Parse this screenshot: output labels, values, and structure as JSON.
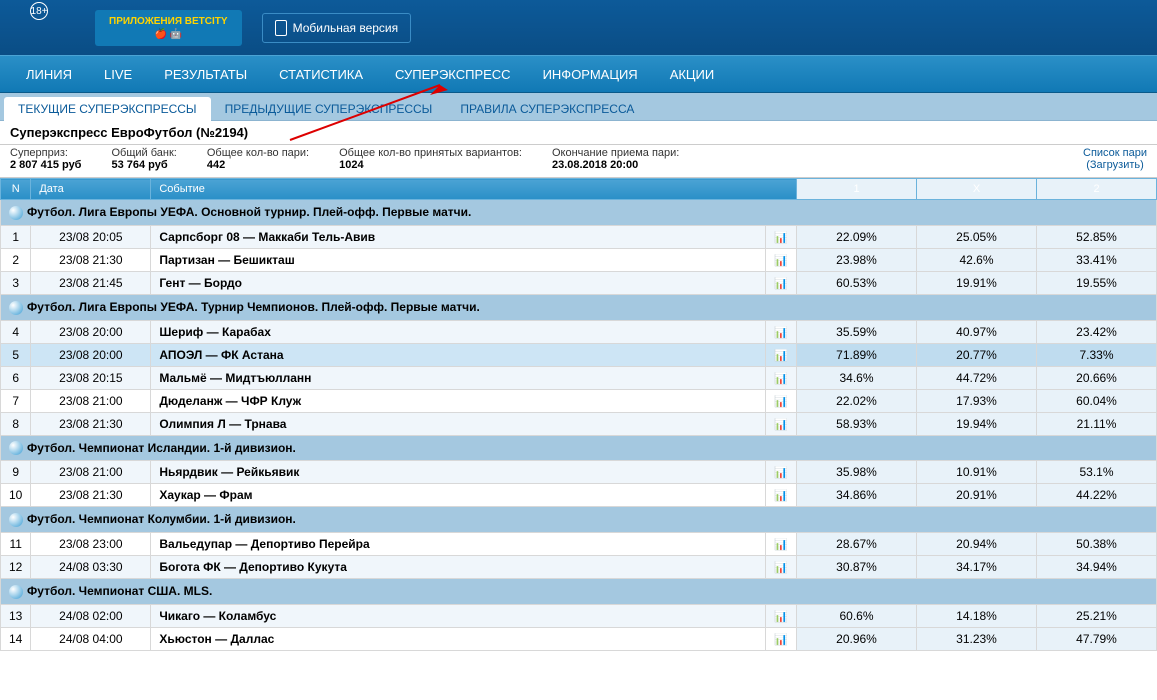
{
  "header": {
    "age": "18+",
    "app_btn": "ПРИЛОЖЕНИЯ BETCITY",
    "mobile_btn": "Мобильная версия"
  },
  "nav": [
    "ЛИНИЯ",
    "LIVE",
    "РЕЗУЛЬТАТЫ",
    "СТАТИСТИКА",
    "СУПЕРЭКСПРЕСС",
    "ИНФОРМАЦИЯ",
    "АКЦИИ"
  ],
  "subnav": [
    "ТЕКУЩИЕ СУПЕРЭКСПРЕССЫ",
    "ПРЕДЫДУЩИЕ СУПЕРЭКСПРЕССЫ",
    "ПРАВИЛА СУПЕРЭКСПРЕССА"
  ],
  "title": "Суперэкспресс ЕвроФутбол (№2194)",
  "info": {
    "superprize_label": "Суперприз:",
    "superprize_value": "2 807 415 руб",
    "bank_label": "Общий банк:",
    "bank_value": "53 764 руб",
    "pari_label": "Общее кол-во пари:",
    "pari_value": "442",
    "variants_label": "Общее кол-во принятых вариантов:",
    "variants_value": "1024",
    "deadline_label": "Окончание приема пари:",
    "deadline_value": "23.08.2018 20:00",
    "link1": "Список пари",
    "link2": "(Загрузить)"
  },
  "th": {
    "n": "N",
    "date": "Дата",
    "event": "Событие",
    "c1": "1",
    "cx": "X",
    "c2": "2"
  },
  "groups": [
    {
      "title": "Футбол. Лига Европы УЕФА. Основной турнир. Плей-офф. Первые матчи.",
      "rows": [
        {
          "n": "1",
          "date": "23/08 20:05",
          "event": "Сарпсборг 08 — Маккаби Тель-Авив",
          "o1": "22.09%",
          "ox": "25.05%",
          "o2": "52.85%"
        },
        {
          "n": "2",
          "date": "23/08 21:30",
          "event": "Партизан — Бешикташ",
          "o1": "23.98%",
          "ox": "42.6%",
          "o2": "33.41%"
        },
        {
          "n": "3",
          "date": "23/08 21:45",
          "event": "Гент — Бордо",
          "o1": "60.53%",
          "ox": "19.91%",
          "o2": "19.55%"
        }
      ]
    },
    {
      "title": "Футбол. Лига Европы УЕФА. Турнир Чемпионов. Плей-офф. Первые матчи.",
      "rows": [
        {
          "n": "4",
          "date": "23/08 20:00",
          "event": "Шериф — Карабах",
          "o1": "35.59%",
          "ox": "40.97%",
          "o2": "23.42%"
        },
        {
          "n": "5",
          "date": "23/08 20:00",
          "event": "АПОЭЛ — ФК Астана",
          "o1": "71.89%",
          "ox": "20.77%",
          "o2": "7.33%",
          "selected": true
        },
        {
          "n": "6",
          "date": "23/08 20:15",
          "event": "Мальмё — Мидтъюлланн",
          "o1": "34.6%",
          "ox": "44.72%",
          "o2": "20.66%"
        },
        {
          "n": "7",
          "date": "23/08 21:00",
          "event": "Дюделанж — ЧФР Клуж",
          "o1": "22.02%",
          "ox": "17.93%",
          "o2": "60.04%"
        },
        {
          "n": "8",
          "date": "23/08 21:30",
          "event": "Олимпия Л — Трнава",
          "o1": "58.93%",
          "ox": "19.94%",
          "o2": "21.11%"
        }
      ]
    },
    {
      "title": "Футбол. Чемпионат Исландии. 1-й дивизион.",
      "rows": [
        {
          "n": "9",
          "date": "23/08 21:00",
          "event": "Ньярдвик — Рейкьявик",
          "o1": "35.98%",
          "ox": "10.91%",
          "o2": "53.1%"
        },
        {
          "n": "10",
          "date": "23/08 21:30",
          "event": "Хаукар — Фрам",
          "o1": "34.86%",
          "ox": "20.91%",
          "o2": "44.22%"
        }
      ]
    },
    {
      "title": "Футбол. Чемпионат Колумбии. 1-й дивизион.",
      "rows": [
        {
          "n": "11",
          "date": "23/08 23:00",
          "event": "Вальедупар — Депортиво Перейра",
          "o1": "28.67%",
          "ox": "20.94%",
          "o2": "50.38%"
        },
        {
          "n": "12",
          "date": "24/08 03:30",
          "event": "Богота ФК — Депортиво Кукута",
          "o1": "30.87%",
          "ox": "34.17%",
          "o2": "34.94%"
        }
      ]
    },
    {
      "title": "Футбол. Чемпионат США. MLS.",
      "rows": [
        {
          "n": "13",
          "date": "24/08 02:00",
          "event": "Чикаго — Коламбус",
          "o1": "60.6%",
          "ox": "14.18%",
          "o2": "25.21%"
        },
        {
          "n": "14",
          "date": "24/08 04:00",
          "event": "Хьюстон — Даллас",
          "o1": "20.96%",
          "ox": "31.23%",
          "o2": "47.79%"
        }
      ]
    }
  ]
}
